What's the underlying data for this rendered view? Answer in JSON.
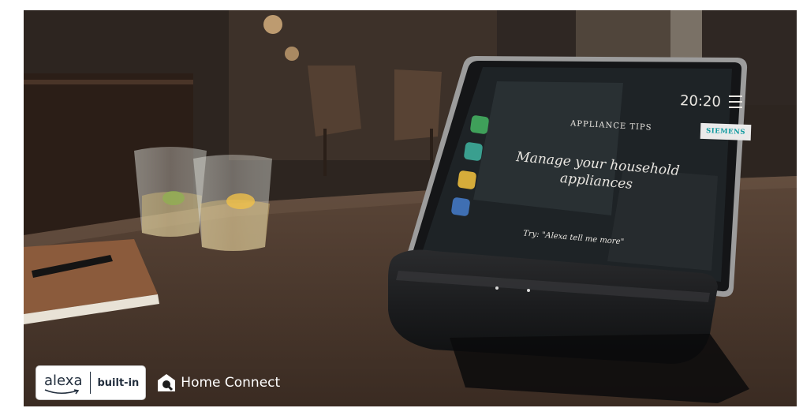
{
  "screen": {
    "time": "20:20",
    "section_title": "APPLIANCE TIPS",
    "headline": "Manage your household appliances",
    "hint": "Try: \"Alexa tell me more\"",
    "brand": "SIEMENS",
    "app_tiles": [
      "green-appliance-icon",
      "teal-appliance-icon",
      "yellow-appliance-icon",
      "blue-appliance-icon"
    ]
  },
  "badges": {
    "alexa_word": "alexa",
    "alexa_suffix": "built-in",
    "home_connect": "Home Connect"
  },
  "colors": {
    "brand_accent": "#0f9aa0",
    "screen_text": "#e9e6e1"
  }
}
